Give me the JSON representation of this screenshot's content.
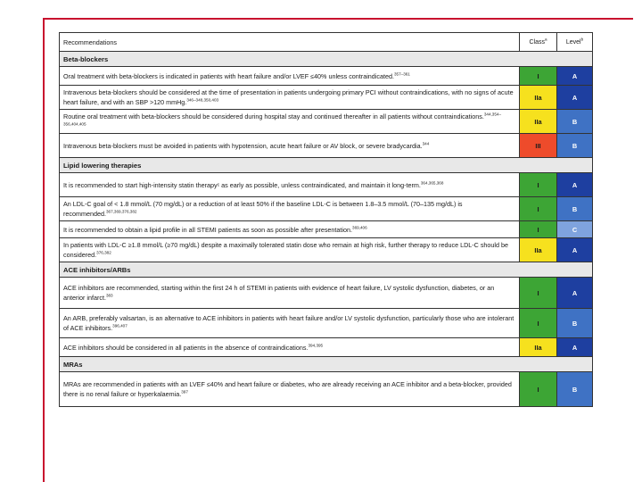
{
  "header": {
    "recommendations": "Recommendations",
    "class": "Class",
    "class_sup": "a",
    "level": "Level",
    "level_sup": "b"
  },
  "colors": {
    "class_I": "#3da535",
    "class_IIa": "#f6e11e",
    "class_III": "#ee4b2b",
    "level_A": "#1e3fa0",
    "level_B": "#3f72c4",
    "level_C": "#7fa3de",
    "frame": "#c8102e"
  },
  "sections": [
    {
      "title": "Beta-blockers",
      "rows": [
        {
          "text": "Oral treatment with beta-blockers is indicated in patients with heart failure and/or LVEF ≤40% unless contraindicated.",
          "ref": "357–361",
          "class": "I",
          "level": "A"
        },
        {
          "text": "Intravenous beta-blockers should be considered at the time of presentation in patients undergoing primary PCI without contraindications, with no signs of acute heart failure, and with an SBP >120 mmHg.",
          "ref": "346–348,350,403",
          "class": "IIa",
          "level": "A"
        },
        {
          "text": "Routine oral treatment with beta-blockers should be considered during hospital stay and continued thereafter in all patients without contraindications.",
          "ref": "344,354–356,404,405",
          "class": "IIa",
          "level": "B"
        },
        {
          "text": "Intravenous beta-blockers must be avoided in patients with hypotension, acute heart failure or AV block, or severe bradycardia.",
          "ref": "344",
          "class": "III",
          "level": "B"
        }
      ]
    },
    {
      "title": "Lipid lowering therapies",
      "rows": [
        {
          "text": "It is recommended to start high-intensity statin therapyᶜ as early as possible, unless contraindicated, and maintain it long-term.",
          "ref": "364,365,368",
          "class": "I",
          "level": "A"
        },
        {
          "text": "An LDL-C goal of < 1.8 mmol/L (70 mg/dL) or a reduction of at least 50% if the baseline LDL-C is between 1.8–3.5 mmol/L (70–135 mg/dL) is recommended.",
          "ref": "367,369,376,382",
          "class": "I",
          "level": "B"
        },
        {
          "text": "It is recommended to obtain a lipid profile in all STEMI patients as soon as possible after presentation.",
          "ref": "369,406",
          "class": "I",
          "level": "C"
        },
        {
          "text": "In patients with LDL-C ≥1.8 mmol/L (≥70 mg/dL) despite a maximally tolerated statin dose who remain at high risk, further therapy to reduce LDL-C should be considered.",
          "ref": "376,382",
          "class": "IIa",
          "level": "A"
        }
      ]
    },
    {
      "title": "ACE inhibitors/ARBs",
      "rows": [
        {
          "text": "ACE inhibitors are recommended, starting within the first 24 h of STEMI in patients with evidence of heart failure, LV systolic dysfunction, diabetes, or an anterior infarct.",
          "ref": "383",
          "class": "I",
          "level": "A"
        },
        {
          "text": "An ARB, preferably valsartan, is an alternative to ACE inhibitors in patients with heart failure and/or LV systolic dysfunction, particularly those who are intolerant of ACE inhibitors.",
          "ref": "396,407",
          "class": "I",
          "level": "B"
        },
        {
          "text": "ACE inhibitors should be considered in all patients in the absence of contraindications.",
          "ref": "394,395",
          "class": "IIa",
          "level": "A"
        }
      ]
    },
    {
      "title": "MRAs",
      "rows": [
        {
          "text": "MRAs are recommended in patients with an LVEF ≤40% and heart failure or diabetes, who are already receiving an ACE inhibitor and a beta-blocker, provided there is no renal failure or hyperkalaemia.",
          "ref": "397",
          "class": "I",
          "level": "B"
        }
      ]
    }
  ]
}
